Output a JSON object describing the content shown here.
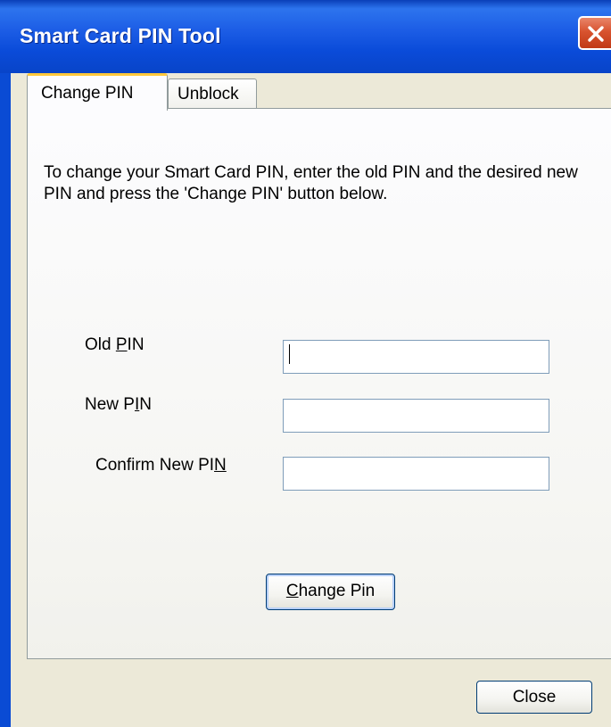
{
  "window": {
    "title": "Smart Card PIN Tool",
    "close_icon": "close-icon"
  },
  "tabs": [
    {
      "label": "Change PIN",
      "selected": true
    },
    {
      "label": "Unblock",
      "selected": false
    }
  ],
  "panel": {
    "instructions": "To change your Smart Card PIN, enter the old PIN and the desired new PIN and press the 'Change PIN' button below.",
    "fields": [
      {
        "label_before": "Old ",
        "mnemonic": "P",
        "label_after": "IN",
        "value": ""
      },
      {
        "label_before": "New P",
        "mnemonic": "I",
        "label_after": "N",
        "value": ""
      },
      {
        "label_before": "Confirm New PI",
        "mnemonic": "N",
        "label_after": "",
        "value": ""
      }
    ],
    "change_button": {
      "mnemonic": "C",
      "label_rest": "hange Pin"
    }
  },
  "footer": {
    "close_label": "Close"
  },
  "colors": {
    "titlebar": "#0a4bd9",
    "close_button": "#d8532f",
    "dialog_background": "#ece9d8",
    "active_tab_accent": "#ffc83c",
    "input_border": "#7f9db9"
  }
}
